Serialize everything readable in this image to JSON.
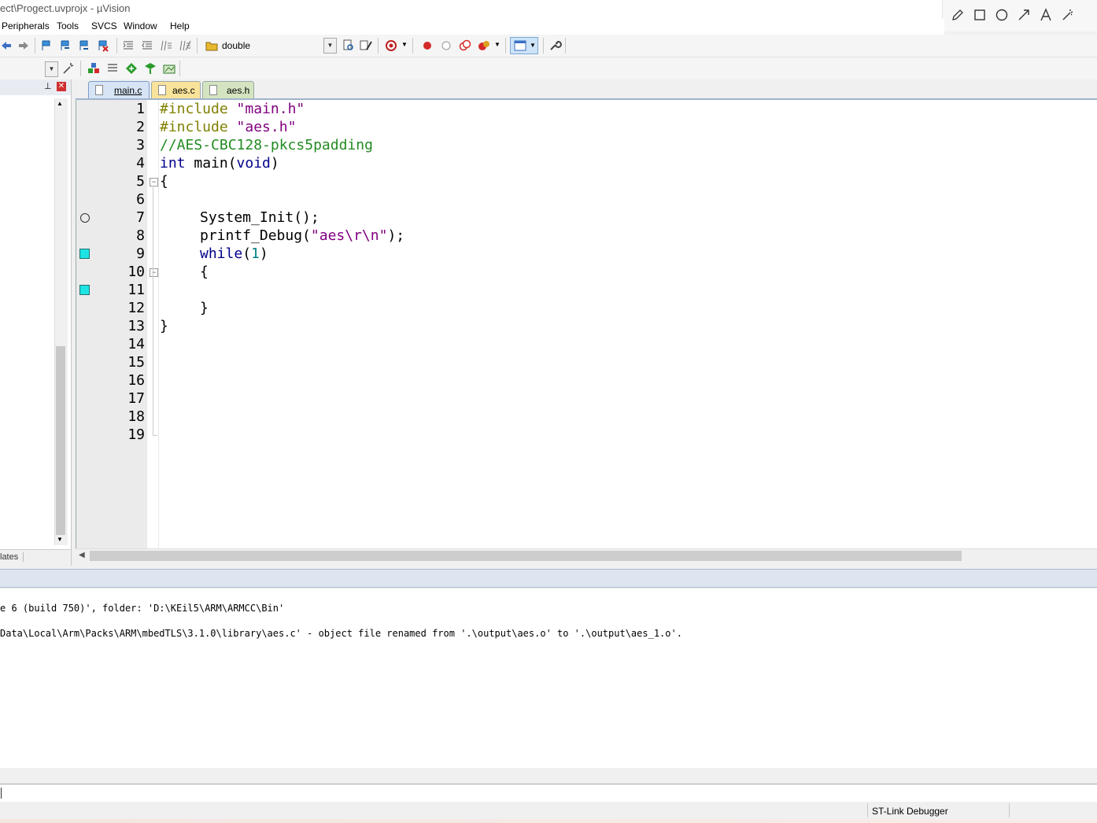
{
  "window": {
    "title": "ect\\Progect.uvprojx - µVision"
  },
  "menu": {
    "items": [
      "Peripherals",
      "Tools",
      "SVCS",
      "Window",
      "Help"
    ]
  },
  "toolbar": {
    "find_combo_value": "double"
  },
  "left_panel": {
    "bottom_tab_label": "lates"
  },
  "tabs": [
    {
      "label": "main.c",
      "active": true,
      "color": "#d6e4f6"
    },
    {
      "label": "aes.c",
      "active": false,
      "color": "#f9e39a"
    },
    {
      "label": "aes.h",
      "active": false,
      "color": "#d4e4c0"
    }
  ],
  "editor": {
    "line_numbers": [
      "1",
      "2",
      "3",
      "4",
      "5",
      "6",
      "7",
      "8",
      "9",
      "10",
      "11",
      "12",
      "13",
      "14",
      "15",
      "16",
      "17",
      "18",
      "19"
    ],
    "lines": {
      "l1_directive": "#include",
      "l1_string": "\"main.h\"",
      "l2_directive": "#include",
      "l2_string": "\"aes.h\"",
      "l3_comment": "//AES-CBC128-pkcs5padding",
      "l4_kw": "int",
      "l4_rest": "main(",
      "l4_void": "void",
      "l4_close": ")",
      "l5": "{",
      "l7": "System_Init();",
      "l8_fn": "printf_Debug(",
      "l8_str": "\"aes\\r\\n\"",
      "l8_end": ");",
      "l9_kw": "while",
      "l9_open": "(",
      "l9_num": "1",
      "l9_close": ")",
      "l10": "{",
      "l12": "}",
      "l13": "}"
    }
  },
  "build_output": {
    "line1": "e 6 (build 750)', folder: 'D:\\KEil5\\ARM\\ARMCC\\Bin'",
    "line2": "Data\\Local\\Arm\\Packs\\ARM\\mbedTLS\\3.1.0\\library\\aes.c' - object file renamed from '.\\output\\aes.o' to '.\\output\\aes_1.o'."
  },
  "status": {
    "debugger": "ST-Link Debugger"
  },
  "colors": {
    "coverage_marker": "#1de4e4",
    "string": "#800080",
    "comment": "#228b22",
    "keyword": "#00008b",
    "preprocessor": "#808000"
  }
}
